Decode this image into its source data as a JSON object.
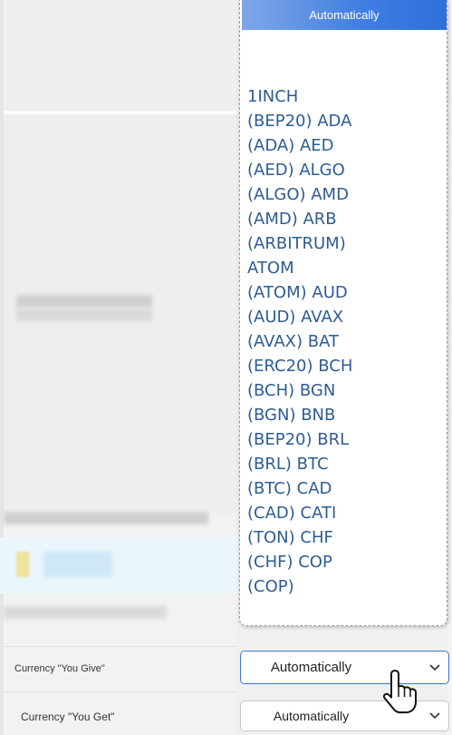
{
  "dropdown": {
    "selected_label": "Automatically",
    "options": [
      "1INCH",
      "(BEP20) ADA",
      "(ADA) AED",
      "(AED) ALGO",
      "(ALGO) AMD",
      "(AMD) ARB",
      "(ARBITRUM)",
      "ATOM",
      "(ATOM) AUD",
      "(AUD) AVAX",
      "(AVAX) BAT",
      "(ERC20) BCH",
      "(BCH) BGN",
      "(BGN) BNB",
      "(BEP20) BRL",
      "(BRL) BTC",
      "(BTC) CAD",
      "(CAD) CATI",
      "(TON) CHF",
      "(CHF) COP",
      "(COP)"
    ]
  },
  "form": {
    "give_label": "Currency \"You Give\"",
    "give_value": "Automatically",
    "get_label": "Currency \"You Get\"",
    "get_value": "Automatically"
  },
  "icons": {
    "chevron": "chevron-down-icon",
    "cursor": "hand-pointer-icon"
  },
  "colors": {
    "option_text": "#2e5c93",
    "selected_bg": "#3f7de0",
    "active_border": "#3a78c9"
  }
}
